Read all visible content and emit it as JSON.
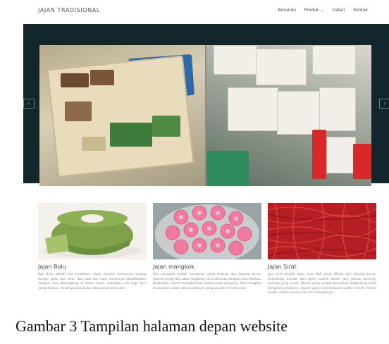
{
  "header": {
    "brand": "JAJAN TRADISIONAL",
    "nav": [
      "Beranda",
      "Produk",
      "Galeri",
      "Kontak"
    ]
  },
  "slider": {
    "prev_icon": "chevron-left-icon",
    "next_icon": "chevron-right-icon"
  },
  "products": [
    {
      "title": "Jajan Bolu",
      "desc": "Kue Bolu adalah kue berbahan dasar tepung (umumnya tepung terigu), gula, dan telur. Kue bolu dan cake umumnya dimatangkan dengan cara dipanggang di dalam oven, walaupun ada juga bolu yang dikukus, misalnya bolu kukus atau brownies kukus."
    },
    {
      "title": "Jajan mangkok",
      "desc": "Kue mangkok adalah penganan yang terbuat dari tepung beras, tepung terigu dan tapai singkong yang dimasak dengan cara dikukus. Berbentuk seperti mangkok dan mekar pada ujungnya. Kue mangkok merupakan salah satu kue basah yang populer di Indonesia."
    },
    {
      "title": "Jajan Sirat",
      "desc": "Jaja sirat adalah jajan khas Bali yang dibuat dari tepung beras, bentuknya bundar dan pipih seperti terdiri dari jalinan benang-benang yang kusut. Warna yang sangat bervariasi tergantung pada keinginan produsen, seperti jajan sirat berwarna putih, merah, merah muda, coklat, kuning dan lain sebagainya."
    }
  ],
  "caption": "Gambar 3 Tampilan halaman depan website",
  "colors": {
    "hero_bg": "#12262b",
    "text_muted": "#888888"
  }
}
